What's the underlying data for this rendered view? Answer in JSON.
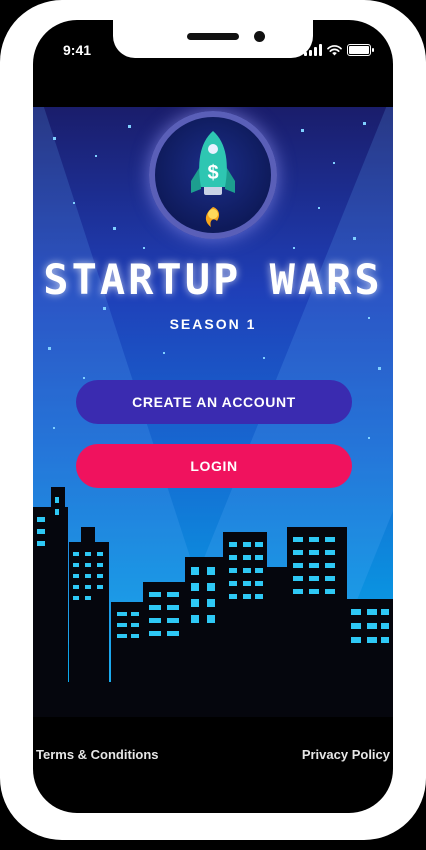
{
  "status_bar": {
    "time": "9:41"
  },
  "app": {
    "title": "STARTUP WARS",
    "subtitle": "SEASON 1",
    "logo_icon": "rocket-dollar-icon"
  },
  "buttons": {
    "create_account": "CREATE AN ACCOUNT",
    "login": "LOGIN"
  },
  "footer": {
    "terms": "Terms & Conditions",
    "privacy": "Privacy Policy"
  },
  "colors": {
    "create_button": "#3a2bb0",
    "login_button": "#f0125e",
    "window_light": "#2ec8f5",
    "building": "#05060d"
  }
}
